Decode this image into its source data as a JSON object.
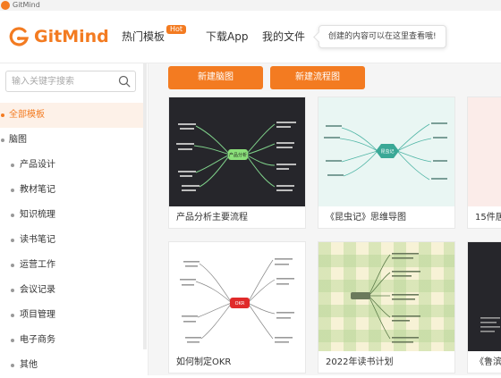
{
  "titlebar": {
    "title": "GitMind"
  },
  "header": {
    "brand": "GitMind",
    "nav": {
      "templates": "热门模板",
      "hot_badge": "Hot",
      "download": "下载App",
      "my_files": "我的文件"
    },
    "tooltip": "创建的内容可以在这里查看哦!"
  },
  "sidebar": {
    "search_placeholder": "输入关键字搜索",
    "items": [
      {
        "label": "全部模板",
        "active": true
      },
      {
        "label": "脑图"
      },
      {
        "label": "产品设计"
      },
      {
        "label": "教材笔记"
      },
      {
        "label": "知识梳理"
      },
      {
        "label": "读书笔记"
      },
      {
        "label": "运营工作"
      },
      {
        "label": "会议记录"
      },
      {
        "label": "项目管理"
      },
      {
        "label": "电子商务"
      },
      {
        "label": "其他"
      }
    ]
  },
  "main": {
    "buttons": {
      "new_mindmap": "新建脑图",
      "new_flowchart": "新建流程图"
    },
    "cards": [
      {
        "title": "产品分析主要流程",
        "center": "产品分析"
      },
      {
        "title": "《昆虫记》思维导图",
        "center": "昆虫记"
      },
      {
        "title": "15件居"
      },
      {
        "title": "如何制定OKR",
        "center": "OKR"
      },
      {
        "title": "2022年读书计划"
      },
      {
        "title": "《鲁滨"
      }
    ]
  },
  "colors": {
    "brand": "#f37b21",
    "dark_thumb": "#26262b",
    "mint_thumb": "#e9f6f3"
  }
}
